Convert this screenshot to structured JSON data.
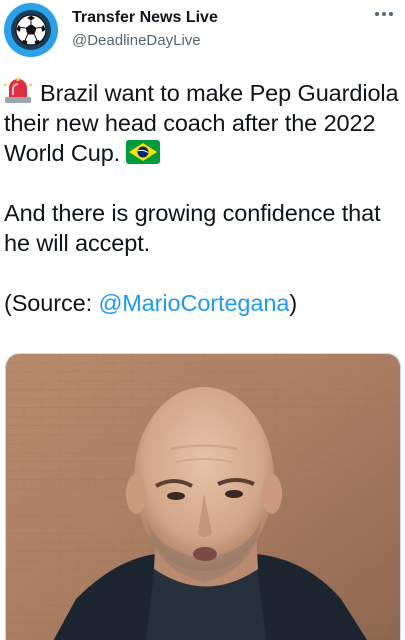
{
  "account": {
    "display_name": "Transfer News Live",
    "handle": "@DeadlineDayLive",
    "avatar_icon": "football-icon"
  },
  "more_icon": "more-horizontal-icon",
  "tweet": {
    "line1_pre": "Brazil want to make Pep Guardiola their new head coach after the 2022 World Cup.",
    "line2": "And there is growing confidence that he will accept.",
    "source_pre": "(Source: ",
    "mention": "@MarioCortegana",
    "source_post": ")",
    "emoji_start": "rotating-light-icon",
    "emoji_end": "brazil-flag-icon"
  },
  "media": {
    "type": "photo",
    "subject": "man-portrait-photo"
  },
  "colors": {
    "link": "#1d9bf0",
    "text": "#0f1419",
    "secondary": "#536471",
    "avatar_ring": "#2aa1e8"
  }
}
